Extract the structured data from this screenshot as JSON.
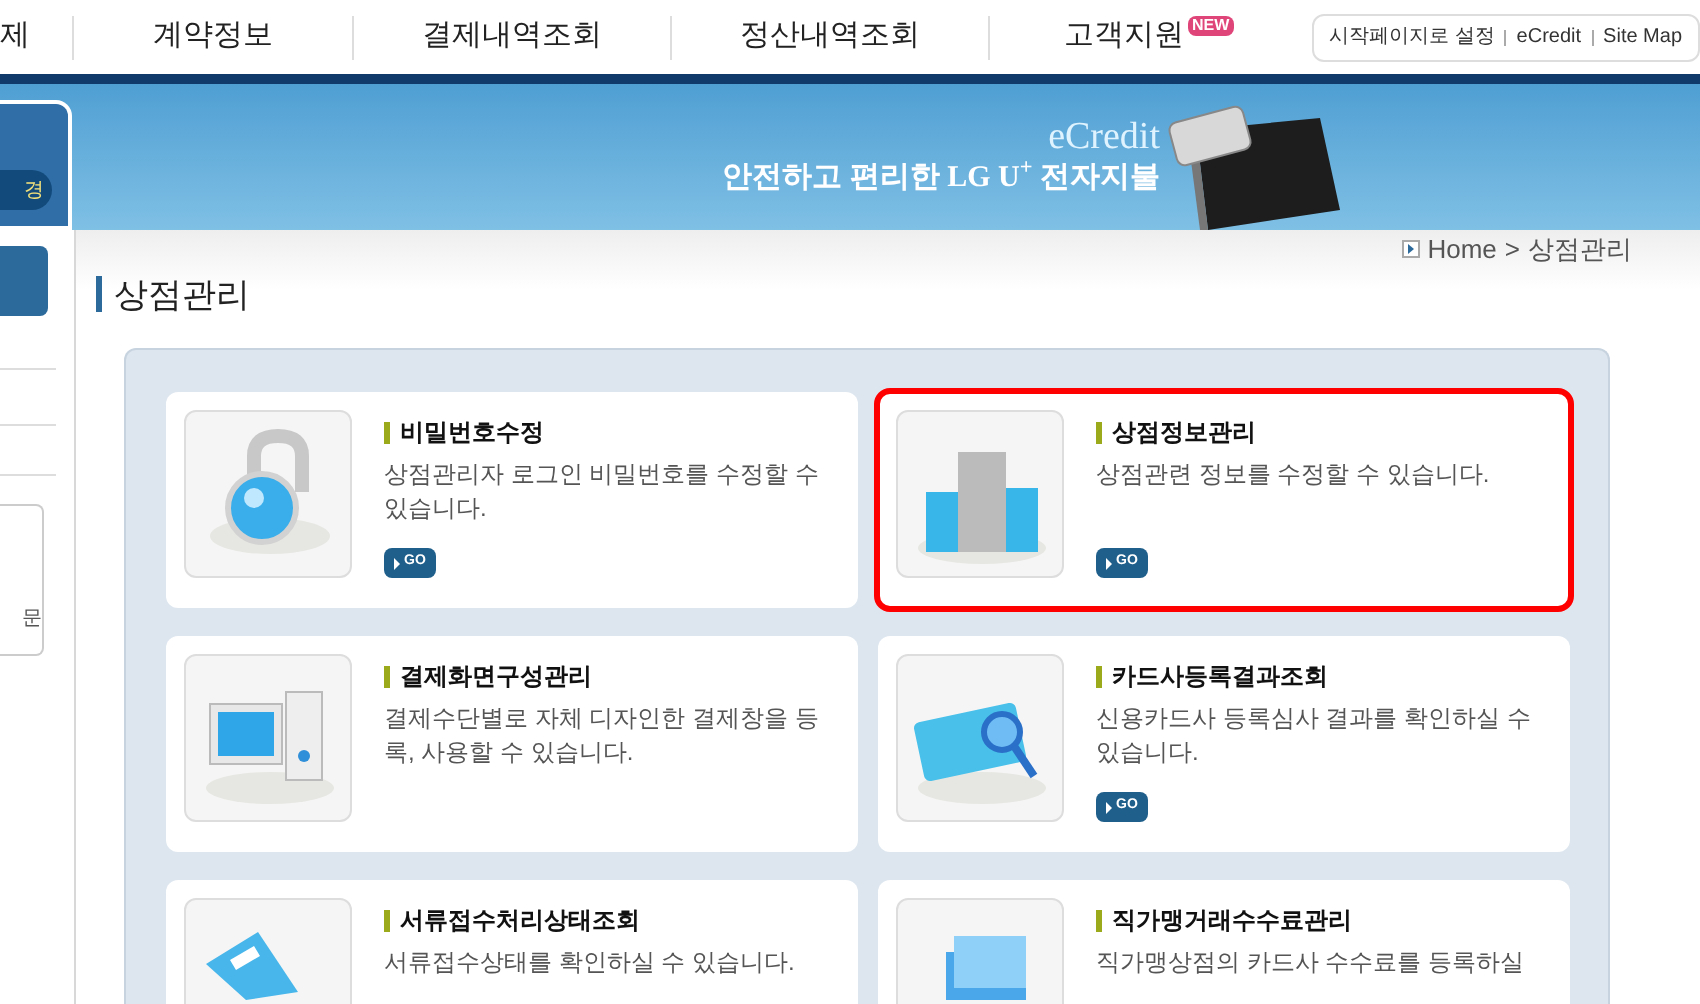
{
  "nav": {
    "items": [
      {
        "label": "제"
      },
      {
        "label": "계약정보"
      },
      {
        "label": "결제내역조회"
      },
      {
        "label": "정산내역조회"
      },
      {
        "label": "고객지원",
        "badge": "NEW"
      }
    ],
    "util_links": [
      "시작페이지로 설정",
      "eCredit",
      "Site Map"
    ]
  },
  "banner": {
    "brand": "eCredit",
    "slogan": "안전하고 편리한 LG U$^{+}$ 전자지불"
  },
  "sidebar": {
    "button": "경",
    "text": "문"
  },
  "breadcrumb": {
    "items": [
      "Home",
      "상점관리"
    ],
    "separator": ">"
  },
  "page_title": "상점관리",
  "cards": [
    {
      "kind": "lock",
      "title": "비밀번호수정",
      "description": "상점관리자 로그인 비밀번호를 수정할 수 있습니다.",
      "go": "GO",
      "selected": false
    },
    {
      "kind": "building",
      "title": "상점정보관리",
      "description": "상점관련 정보를 수정할 수 있습니다.",
      "go": "GO",
      "selected": true
    },
    {
      "kind": "monitor",
      "title": "결제화면구성관리",
      "description": "결제수단별로 자체 디자인한 결제창을 등록, 사용할 수 있습니다.",
      "selected": false
    },
    {
      "kind": "card",
      "title": "카드사등록결과조회",
      "description": "신용카드사 등록심사 결과를 확인하실 수 있습니다.",
      "go": "GO",
      "selected": false
    },
    {
      "kind": "document",
      "title": "서류접수처리상태조회",
      "description": "서류접수상태를 확인하실 수 있습니다.",
      "selected": false
    },
    {
      "kind": "folder",
      "title": "직가맹거래수수료관리",
      "description": "직가맹상점의 카드사 수수료를 등록하실",
      "selected": false
    }
  ]
}
